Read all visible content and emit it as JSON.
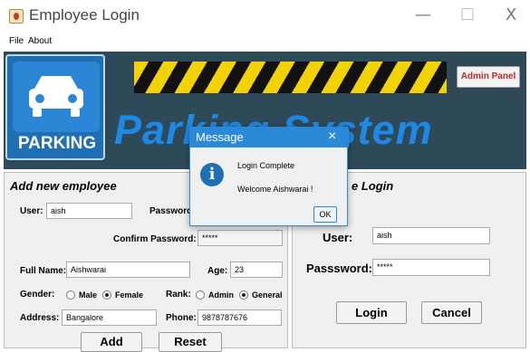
{
  "window": {
    "title": "Employee Login",
    "minimize": "—",
    "maximize": "☐",
    "close": "X"
  },
  "menu": [
    "File",
    "About"
  ],
  "header": {
    "logo_label": "PARKING",
    "admin_button": "Admin Panel",
    "system_title": "Parking System"
  },
  "add_employee": {
    "title": "Add new employee",
    "user_label": "User:",
    "user_value": "aish",
    "password_label": "Password:",
    "confirm_label": "Confirm Password:",
    "confirm_value": "*****",
    "fullname_label": "Full Name:",
    "fullname_value": "Aishwarai",
    "age_label": "Age:",
    "age_value": "23",
    "gender_label": "Gender:",
    "gender_options": [
      "Male",
      "Female"
    ],
    "gender_selected": "Female",
    "rank_label": "Rank:",
    "rank_options": [
      "Admin",
      "General"
    ],
    "rank_selected": "General",
    "address_label": "Address:",
    "address_value": "Bangalore",
    "phone_label": "Phone:",
    "phone_value": "9878787676",
    "add_button": "Add",
    "reset_button": "Reset"
  },
  "login": {
    "title": "e Login",
    "user_label": "User:",
    "user_value": "aish",
    "password_label": "Passsword:",
    "password_value": "*****",
    "login_button": "Login",
    "cancel_button": "Cancel"
  },
  "dialog": {
    "title": "Message",
    "close": "×",
    "line1": "Login Complete",
    "line2": "Welcome Aishwarai !",
    "ok_button": "OK",
    "icon": "info-icon"
  },
  "colors": {
    "title_blue": "#1e88e5",
    "header_bg": "#2e4a59",
    "admin_text": "#c0272d",
    "dialog_accent": "#2a8ad8"
  }
}
